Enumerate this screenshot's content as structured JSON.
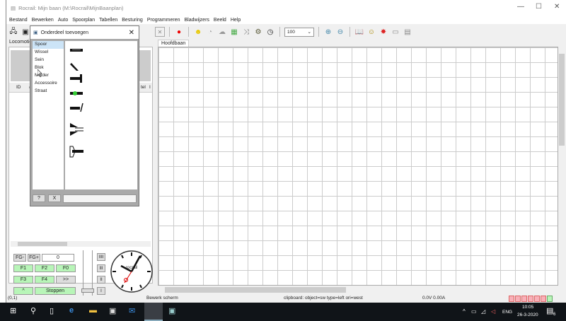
{
  "window": {
    "title": "Rocrail: Mijn baan (M:\\Rocrail\\MijnBaanplan)"
  },
  "menu": [
    "Bestand",
    "Bewerken",
    "Auto",
    "Spoorplan",
    "Tabellen",
    "Besturing",
    "Programmeren",
    "Bladwijzers",
    "Beeld",
    "Help"
  ],
  "toolbar": {
    "zoom": "100"
  },
  "left_panel": {
    "tab": "Locomotieven",
    "columns": [
      "ID",
      "#",
      "tel",
      "I"
    ]
  },
  "canvas": {
    "tab": "Hoofdbaan"
  },
  "throttle": {
    "fg_minus": "FG-",
    "fg_plus": "FG+",
    "speed": "0",
    "f1": "F1",
    "f2": "F2",
    "f0": "F0",
    "f3": "F3",
    "f4": "F4",
    "more": ">>",
    "dir": "^",
    "stop": "Stoppen",
    "gears": [
      "IIII",
      "III",
      "II",
      "I"
    ],
    "clock_brand": "rocrail"
  },
  "dialog": {
    "title": "Onderdeel toevoegen",
    "categories": [
      "Spoor",
      "Wissel",
      "Sein",
      "Blok",
      "Melder",
      "Accessoire",
      "Straat"
    ],
    "selected": "Spoor",
    "help": "?",
    "close": "X"
  },
  "status": {
    "coords": "(0,1)",
    "mode": "Bewerk scherm",
    "clipboard": "clipboard: object=sw type=left ori=west",
    "power": "0.0V 0.00A"
  },
  "taskbar": {
    "time": "10:05",
    "date": "26-3-2020",
    "lang": "ENG",
    "notif": "6"
  }
}
